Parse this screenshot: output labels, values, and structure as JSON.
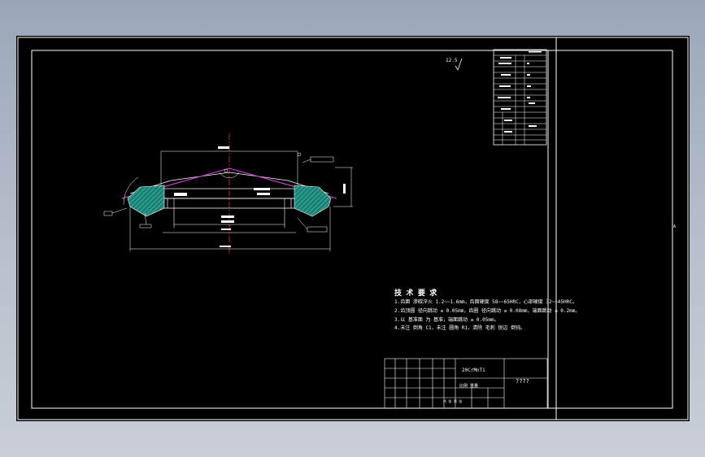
{
  "colors": {
    "desktop_top": "#9aa6b8",
    "canvas": "#000000",
    "line": "#ffffff",
    "section_hatch": "#2ea89a",
    "pitch_line": "#c33cc8",
    "centerline": "#e03030"
  },
  "drawing": {
    "roughness_symbol": "12.5",
    "technical_requirements": {
      "title": "技 术 要 求",
      "items": [
        "1.齿面 渗碳淬火 1.2~~1.6mm，齿面硬度 58~~65HRC，心部硬度 32~~45HRC。",
        "2.齿顶圆 径向跳动 ≤ 0.05mm，齿圈 径向跳动 ≤ 0.08mm，端面跳动 ≤ 0.2mm。",
        "3.以 基准面 为 基准，端面跳动 ≤ 0.05mm。",
        "4.未注 倒角 C1，未注 圆角 R1，清除 毛刺 锐边 倒钝。"
      ]
    },
    "title_block": {
      "material": "20CrMnTi",
      "part_name": "????",
      "scale_row": "比例 重量",
      "sheet_row": "共 张 第 张"
    },
    "side_mark": "A"
  }
}
